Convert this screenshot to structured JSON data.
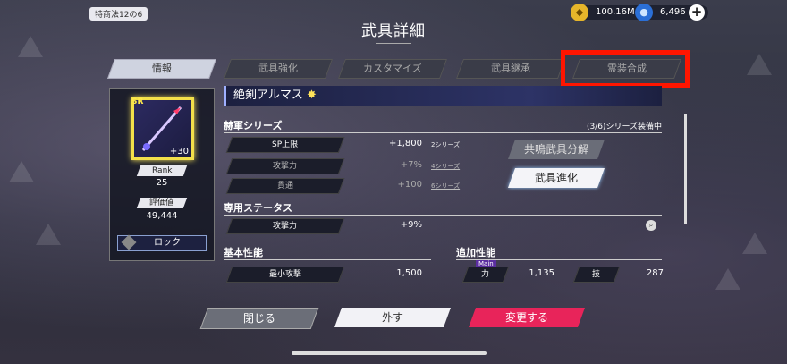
{
  "header": {
    "badge": "特商法12の6",
    "title": "武具詳細",
    "gold": "100.16M",
    "gems": "6,496",
    "plus": "+"
  },
  "tabs": [
    {
      "label": "情報",
      "active": true
    },
    {
      "label": "武具強化"
    },
    {
      "label": "カスタマイズ"
    },
    {
      "label": "武具継承"
    },
    {
      "label": "霊装合成"
    }
  ],
  "card": {
    "rarity": "SR",
    "level": "+30",
    "rank_label": "Rank",
    "rank_value": "25",
    "rating_label": "評価値",
    "rating_value": "49,444",
    "lock_label": "ロック"
  },
  "weapon": {
    "name": "絶剣アルマス"
  },
  "series": {
    "title": "赫軍シリーズ",
    "status": "(3/6)シリーズ装備中",
    "rows": [
      {
        "label": "SP上限",
        "value": "+1,800",
        "req": "2シリーズ"
      },
      {
        "label": "攻撃力",
        "value": "+7%",
        "req": "4シリーズ"
      },
      {
        "label": "貫通",
        "value": "+100",
        "req": "6シリーズ"
      }
    ]
  },
  "side_buttons": {
    "dismantle": "共鳴武具分解",
    "evolve": "武具進化"
  },
  "exclusive": {
    "title": "専用ステータス",
    "label": "攻撃力",
    "value": "+9%"
  },
  "base": {
    "title": "基本性能",
    "label": "最小攻撃",
    "value": "1,500"
  },
  "extra": {
    "title": "追加性能",
    "main_tag": "Main",
    "stat1_label": "力",
    "stat1_value": "1,135",
    "stat2_label": "技",
    "stat2_value": "287"
  },
  "footer": {
    "close": "閉じる",
    "remove": "外す",
    "change": "変更する"
  },
  "colors": {
    "highlight": "#ff1500",
    "change_button": "#e8245a"
  }
}
